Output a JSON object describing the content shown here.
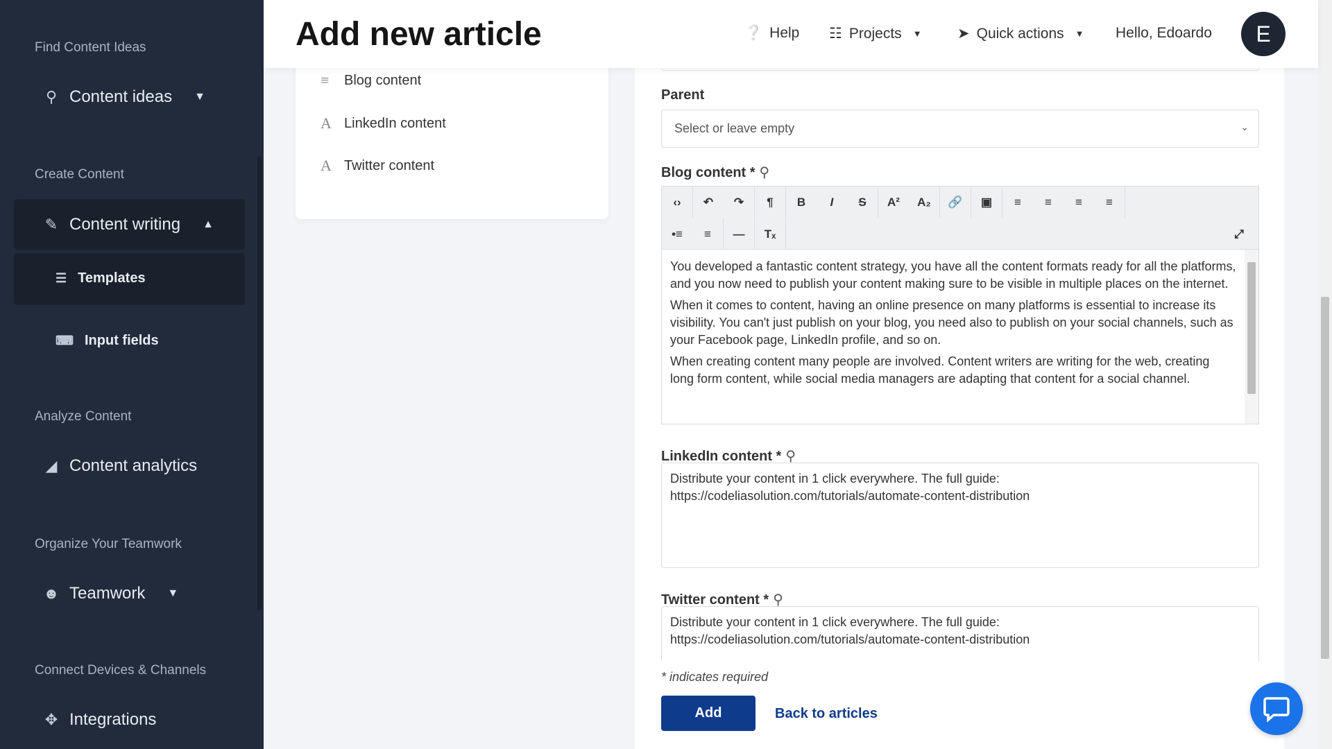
{
  "sidebar": {
    "sections": [
      "Find Content Ideas",
      "Create Content",
      "Analyze Content",
      "Organize Your Teamwork",
      "Connect Devices & Channels"
    ],
    "content_ideas": "Content ideas",
    "content_writing": "Content writing",
    "templates": "Templates",
    "input_fields": "Input fields",
    "content_analytics": "Content analytics",
    "teamwork": "Teamwork",
    "integrations": "Integrations"
  },
  "header": {
    "title": "Add new article",
    "help": "Help",
    "projects": "Projects",
    "quick_actions": "Quick actions",
    "greeting": "Hello, Edoardo",
    "avatar_initial": "E"
  },
  "left_card": {
    "items": [
      "Blog content",
      "LinkedIn content",
      "Twitter content"
    ]
  },
  "form": {
    "parent_label": "Parent",
    "parent_placeholder": "Select or leave empty",
    "blog_label": "Blog content *",
    "blog_paragraphs": [
      "You developed a fantastic content strategy, you have all the content formats ready for all the platforms, and you now need to publish your content making sure to be visible in multiple places on the internet.",
      "When it comes to content, having an online presence on many platforms is essential to increase its visibility. You can't just publish on your blog, you need also to publish on your social channels, such as your Facebook page, LinkedIn profile, and so on.",
      "When creating content many people are involved. Content writers are writing for the web, creating long form content, while social media managers are adapting that content for a social channel."
    ],
    "linkedin_label": "LinkedIn content *",
    "linkedin_value": "Distribute your content in 1 click everywhere. The full guide: https://codeliasolution.com/tutorials/automate-content-distribution",
    "twitter_label": "Twitter content *",
    "twitter_value": "Distribute your content in 1 click everywhere. The full guide: https://codeliasolution.com/tutorials/automate-content-distribution",
    "required_note": "* indicates required",
    "add": "Add",
    "back": "Back to articles"
  },
  "colors": {
    "sidebar": "#222b3b",
    "primary": "#0f3b8c",
    "chat": "#1a73e8"
  }
}
